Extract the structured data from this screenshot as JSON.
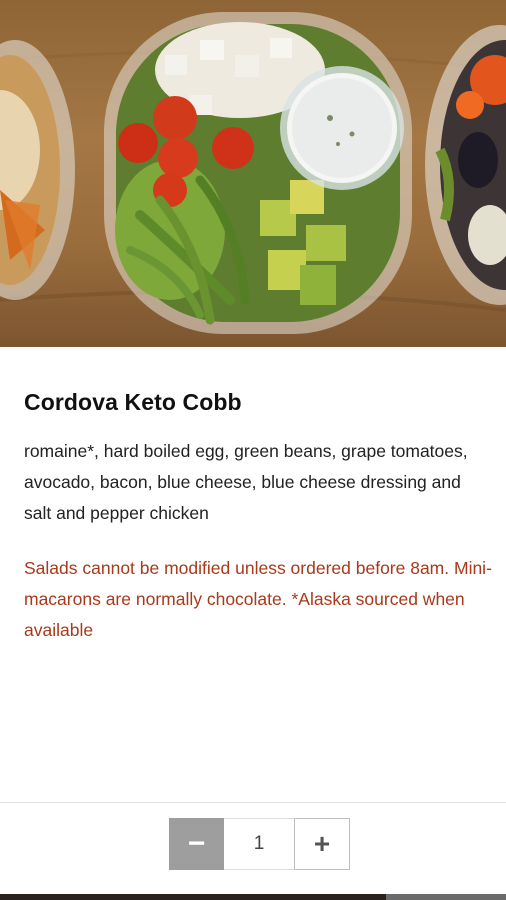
{
  "product": {
    "title": "Cordova Keto Cobb",
    "description": "romaine*, hard boiled egg, green beans, grape tomatoes, avocado, bacon, blue cheese, blue cheese dressing and salt and pepper chicken",
    "note": "Salads cannot be modified unless ordered before 8am. Mini-macarons are normally chocolate. *Alaska sourced when available"
  },
  "quantity": {
    "minus_symbol": "−",
    "value": "1",
    "plus_symbol": "+"
  },
  "colors": {
    "note_text": "#a8391b",
    "minus_button": "#9e9e9e"
  },
  "icons": {
    "minus": "minus-icon",
    "plus": "plus-icon"
  }
}
